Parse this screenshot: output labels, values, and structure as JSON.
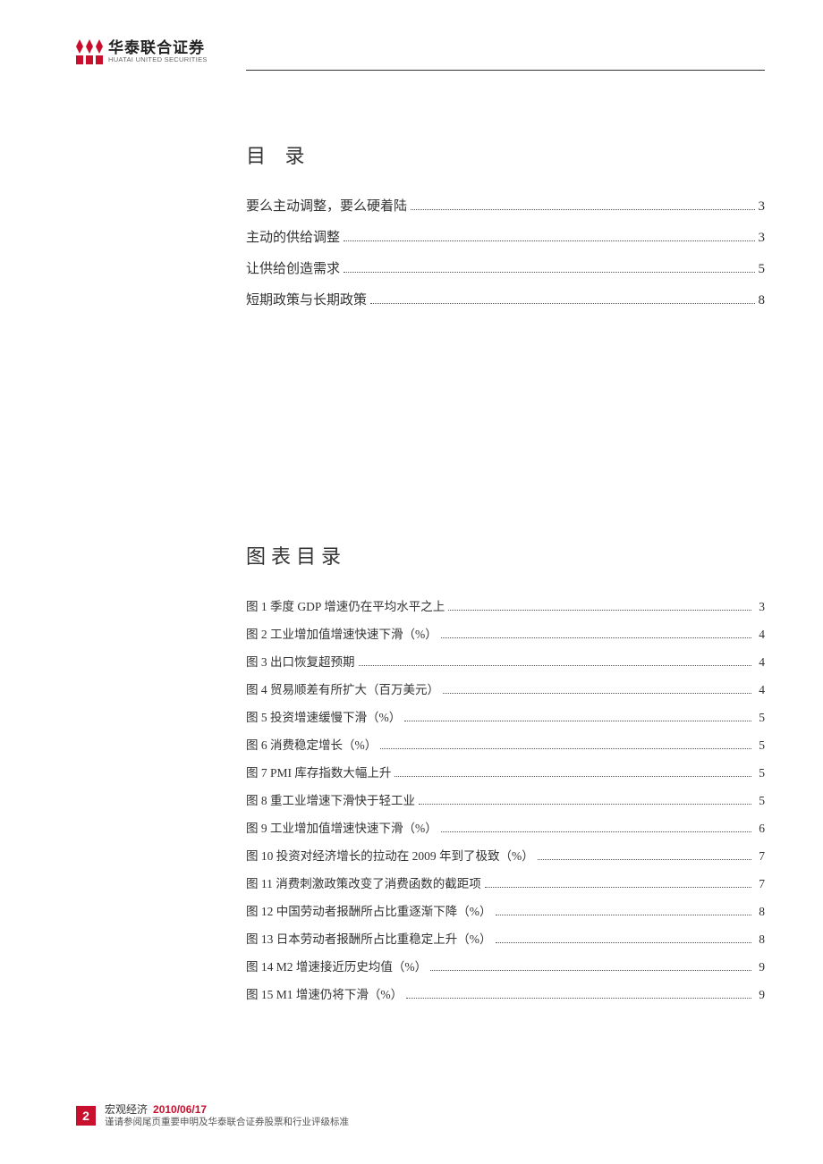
{
  "header": {
    "logo_cn": "华泰联合证券",
    "logo_en": "HUATAI UNITED SECURITIES"
  },
  "toc": {
    "title": "目 录",
    "items": [
      {
        "label": "要么主动调整，要么硬着陆",
        "page": "3"
      },
      {
        "label": "主动的供给调整",
        "page": "3"
      },
      {
        "label": "让供给创造需求",
        "page": "5"
      },
      {
        "label": "短期政策与长期政策",
        "page": "8"
      }
    ]
  },
  "figtoc": {
    "title": "图表目录",
    "items": [
      {
        "label": "图 1 季度 GDP 增速仍在平均水平之上",
        "page": "3"
      },
      {
        "label": "图 2 工业增加值增速快速下滑（%）",
        "page": "4"
      },
      {
        "label": "图 3 出口恢复超预期",
        "page": "4"
      },
      {
        "label": "图 4 贸易顺差有所扩大（百万美元）",
        "page": "4"
      },
      {
        "label": "图 5 投资增速缓慢下滑（%）",
        "page": "5"
      },
      {
        "label": "图 6 消费稳定增长（%）",
        "page": "5"
      },
      {
        "label": "图 7 PMI 库存指数大幅上升",
        "page": "5"
      },
      {
        "label": "图 8 重工业增速下滑快于轻工业",
        "page": "5"
      },
      {
        "label": "图 9 工业增加值增速快速下滑（%）",
        "page": "6"
      },
      {
        "label": "图 10 投资对经济增长的拉动在 2009 年到了极致（%）",
        "page": "7"
      },
      {
        "label": "图 11 消费刺激政策改变了消费函数的截距项",
        "page": "7"
      },
      {
        "label": "图 12 中国劳动者报酬所占比重逐渐下降（%）",
        "page": "8"
      },
      {
        "label": "图 13 日本劳动者报酬所占比重稳定上升（%）",
        "page": "8"
      },
      {
        "label": "图 14 M2 增速接近历史均值（%）",
        "page": "9"
      },
      {
        "label": "图 15 M1 增速仍将下滑（%）",
        "page": "9"
      }
    ]
  },
  "footer": {
    "page_number": "2",
    "category": "宏观经济",
    "date": "2010/06/17",
    "disclaimer": "谨请参阅尾页重要申明及华泰联合证券股票和行业评级标准"
  }
}
